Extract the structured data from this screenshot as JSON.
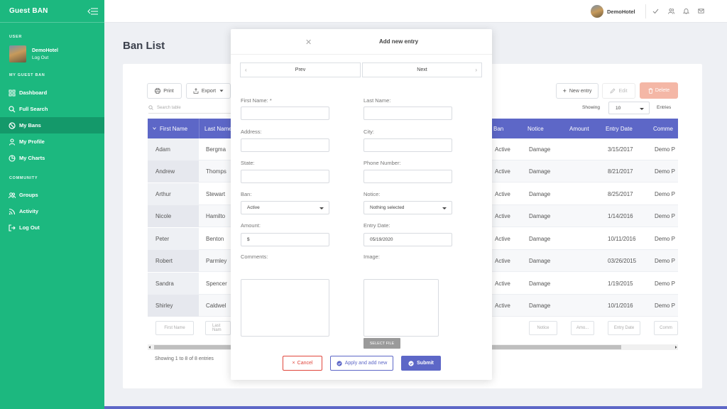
{
  "sidebar": {
    "title": "Guest BAN",
    "section_user": "USER",
    "user_name": "DemoHotel",
    "user_logout": "Log Out",
    "section_main": "MY GUEST BAN",
    "items": [
      {
        "label": "Dashboard",
        "icon": "grid-icon"
      },
      {
        "label": "Full Search",
        "icon": "search-icon"
      },
      {
        "label": "My Bans",
        "icon": "ban-icon"
      },
      {
        "label": "My Profile",
        "icon": "user-icon"
      },
      {
        "label": "My Charts",
        "icon": "chart-icon"
      }
    ],
    "section_community": "COMMUNITY",
    "community": [
      {
        "label": "Groups",
        "icon": "group-icon"
      },
      {
        "label": "Activity",
        "icon": "rss-icon"
      },
      {
        "label": "Log Out",
        "icon": "logout-icon"
      }
    ]
  },
  "topbar": {
    "user_name": "DemoHotel"
  },
  "page": {
    "title": "Ban List"
  },
  "toolbar": {
    "print": "Print",
    "export": "Export",
    "new_entry": "New entry",
    "edit": "Edit",
    "delete": "Delete"
  },
  "search": {
    "placeholder": "Search table"
  },
  "showing": {
    "label": "Showing",
    "value": "10",
    "entries": "Entries"
  },
  "table": {
    "headers": [
      "First Name",
      "Last Name",
      "Ban",
      "Notice",
      "Amount",
      "Entry Date",
      "Comme"
    ],
    "rows": [
      {
        "first": "Adam",
        "last": "Bergma",
        "ban": "Active",
        "notice": "Damage",
        "date": "3/15/2017",
        "comment": "Demo P"
      },
      {
        "first": "Andrew",
        "last": "Thomps",
        "ban": "Active",
        "notice": "Damage",
        "date": "8/21/2017",
        "comment": "Demo P"
      },
      {
        "first": "Arthur",
        "last": "Stewart",
        "ban": "Active",
        "notice": "Damage",
        "date": "8/25/2017",
        "comment": "Demo P"
      },
      {
        "first": "Nicole",
        "last": "Hamilto",
        "ban": "Active",
        "notice": "Damage",
        "date": "1/14/2016",
        "comment": "Demo P"
      },
      {
        "first": "Peter",
        "last": "Benton",
        "ban": "Active",
        "notice": "Damage",
        "date": "10/11/2016",
        "comment": "Demo P"
      },
      {
        "first": "Robert",
        "last": "Parmley",
        "ban": "Active",
        "notice": "Damage",
        "date": "03/26/2015",
        "comment": "Demo P"
      },
      {
        "first": "Sandra",
        "last": "Spencer",
        "ban": "Active",
        "notice": "Damage",
        "date": "1/19/2015",
        "comment": "Demo P"
      },
      {
        "first": "Shirley",
        "last": "Caldwel",
        "ban": "Active",
        "notice": "Damage",
        "date": "10/1/2016",
        "comment": "Demo P"
      }
    ],
    "filters": [
      "First Name",
      "Last Nam",
      "Notice",
      "Amo...",
      "Entry Date",
      "Comm"
    ],
    "footer": "Showing 1 to 8 of 8 entries"
  },
  "modal": {
    "title": "Add new entry",
    "prev": "Prev",
    "next": "Next",
    "labels": {
      "first_name": "First Name: *",
      "last_name": "Last Name:",
      "address": "Address:",
      "city": "City:",
      "state": "State:",
      "phone": "Phone Number:",
      "ban": "Ban:",
      "notice": "Notice:",
      "amount": "Amount:",
      "entry_date": "Entry Date:",
      "comments": "Comments:",
      "image": "Image:"
    },
    "values": {
      "ban": "Active",
      "notice": "Nothing selected",
      "amount": "$",
      "entry_date": "05/19/2020"
    },
    "select_file": "SELECT FILE",
    "cancel": "Cancel",
    "apply": "Apply and add new",
    "submit": "Submit"
  },
  "colors": {
    "sidebar": "#1cb87f",
    "sidebar_active": "#14996a",
    "table_header": "#5d67c7",
    "delete": "#f4b7a6",
    "cancel": "#e0463c",
    "submit": "#5d67c7"
  }
}
